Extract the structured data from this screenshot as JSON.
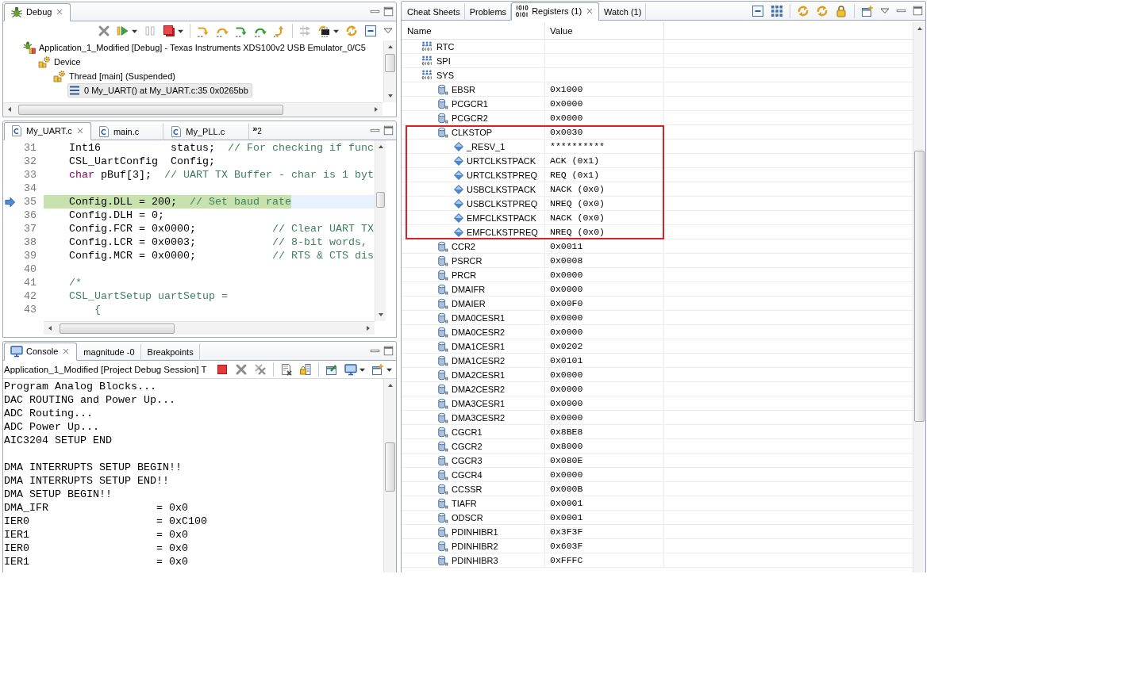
{
  "debug_view": {
    "tabs": [
      {
        "label": "Debug",
        "selected": true
      }
    ],
    "tree": [
      {
        "label": "Application_1_Modified [Debug] - Texas Instruments XDS100v2 USB Emulator_0/C5",
        "kind": "launch",
        "selected": false,
        "children": [
          {
            "label": "Device",
            "kind": "device",
            "selected": false,
            "children": [
              {
                "label": "Thread [main] (Suspended)",
                "kind": "thread",
                "selected": false,
                "children": [
                  {
                    "label": "0 My_UART() at My_UART.c:35 0x0265bb",
                    "kind": "frame",
                    "selected": true
                  }
                ]
              }
            ]
          }
        ]
      }
    ]
  },
  "editor": {
    "tabs": [
      {
        "label": "My_UART.c",
        "selected": true
      },
      {
        "label": "main.c",
        "selected": false
      },
      {
        "label": "My_PLL.c",
        "selected": false
      }
    ],
    "more_tabs": {
      "glyph": "»",
      "count": "2"
    },
    "lines": [
      {
        "number": "31",
        "current": false,
        "tokens": [
          {
            "text": "    Int16           status;  ",
            "kind": "code"
          },
          {
            "text": "// For checking if func",
            "kind": "comment"
          }
        ]
      },
      {
        "number": "32",
        "current": false,
        "tokens": [
          {
            "text": "    CSL_UartConfig  Config;",
            "kind": "code"
          }
        ]
      },
      {
        "number": "33",
        "current": false,
        "tokens": [
          {
            "text": "    char",
            "kind": "keyword"
          },
          {
            "text": " pBuf[3];  ",
            "kind": "code"
          },
          {
            "text": "// UART TX Buffer - char is 1 byt",
            "kind": "comment"
          }
        ]
      },
      {
        "number": "34",
        "current": false
      },
      {
        "number": "35",
        "current": true,
        "tokens": [
          {
            "text": "    Config.DLL = 200;  ",
            "kind": "code"
          },
          {
            "text": "// Set baud rate",
            "kind": "comment"
          }
        ]
      },
      {
        "number": "36",
        "current": false,
        "tokens": [
          {
            "text": "    Config.DLH = 0;",
            "kind": "code"
          }
        ]
      },
      {
        "number": "37",
        "current": false,
        "tokens": [
          {
            "text": "    Config.FCR = 0x0000;            ",
            "kind": "code"
          },
          {
            "text": "// Clear UART TX",
            "kind": "comment"
          }
        ]
      },
      {
        "number": "38",
        "current": false,
        "tokens": [
          {
            "text": "    Config.LCR = 0x0003;            ",
            "kind": "code"
          },
          {
            "text": "// 8-bit words,",
            "kind": "comment"
          }
        ]
      },
      {
        "number": "39",
        "current": false,
        "tokens": [
          {
            "text": "    Config.MCR = 0x0000;            ",
            "kind": "code"
          },
          {
            "text": "// RTS & CTS dis",
            "kind": "comment"
          }
        ]
      },
      {
        "number": "40",
        "current": false
      },
      {
        "number": "41",
        "current": false,
        "tokens": [
          {
            "text": "    /*",
            "kind": "comment"
          }
        ]
      },
      {
        "number": "42",
        "current": false,
        "tokens": [
          {
            "text": "    CSL_UartSetup uartSetup =",
            "kind": "comment"
          }
        ]
      },
      {
        "number": "43",
        "current": false,
        "tokens": [
          {
            "text": "        {",
            "kind": "comment"
          }
        ]
      }
    ]
  },
  "console_view": {
    "tabs": [
      {
        "label": "Console",
        "selected": true
      },
      {
        "label": "magnitude -0",
        "selected": false
      },
      {
        "label": "Breakpoints",
        "selected": false
      }
    ],
    "session": "Application_1_Modified [Project Debug Session] T",
    "paragraphs": [
      [
        "Program Analog Blocks...",
        "DAC ROUTING and Power Up...",
        "ADC Routing...",
        "ADC Power Up...",
        "AIC3204 SETUP END"
      ],
      [
        "DMA INTERRUPTS SETUP BEGIN!!",
        "DMA INTERRUPTS SETUP END!!",
        "DMA SETUP BEGIN!!",
        "DMA_IFR                 = 0x0",
        "IER0                    = 0xC100",
        "IER1                    = 0x0",
        "IER0                    = 0x0",
        "IER1                    = 0x0"
      ]
    ]
  },
  "registers_view": {
    "tabs": [
      {
        "label": "Cheat Sheets",
        "selected": false
      },
      {
        "label": "Problems",
        "selected": false
      },
      {
        "label": "Registers (1)",
        "selected": true
      },
      {
        "label": "Watch (1)",
        "selected": false
      }
    ],
    "columns": [
      "Name",
      "Value"
    ],
    "rows": [
      {
        "name": "RTC",
        "kind": "group"
      },
      {
        "name": "SPI",
        "kind": "group"
      },
      {
        "name": "SYS",
        "kind": "group",
        "children": [
          {
            "name": "EBSR",
            "value": "0x1000",
            "kind": "register",
            "highlighted": false
          },
          {
            "name": "PCGCR1",
            "value": "0x0000",
            "kind": "register",
            "highlighted": false
          },
          {
            "name": "PCGCR2",
            "value": "0x0000",
            "kind": "register",
            "highlighted": false
          },
          {
            "name": "CLKSTOP",
            "value": "0x0030",
            "kind": "register",
            "highlighted": true,
            "children": [
              {
                "name": "_RESV_1",
                "value": "**********",
                "kind": "field"
              },
              {
                "name": "URTCLKSTPACK",
                "value": "ACK (0x1)",
                "kind": "field"
              },
              {
                "name": "URTCLKSTPREQ",
                "value": "REQ (0x1)",
                "kind": "field"
              },
              {
                "name": "USBCLKSTPACK",
                "value": "NACK (0x0)",
                "kind": "field"
              },
              {
                "name": "USBCLKSTPREQ",
                "value": "NREQ (0x0)",
                "kind": "field"
              },
              {
                "name": "EMFCLKSTPACK",
                "value": "NACK (0x0)",
                "kind": "field"
              },
              {
                "name": "EMFCLKSTPREQ",
                "value": "NREQ (0x0)",
                "kind": "field"
              }
            ]
          },
          {
            "name": "CCR2",
            "value": "0x0011",
            "kind": "register",
            "highlighted": false
          },
          {
            "name": "PSRCR",
            "value": "0x0008",
            "kind": "register",
            "highlighted": false
          },
          {
            "name": "PRCR",
            "value": "0x0000",
            "kind": "register",
            "highlighted": false
          },
          {
            "name": "DMAIFR",
            "value": "0x0000",
            "kind": "register",
            "highlighted": false
          },
          {
            "name": "DMAIER",
            "value": "0x00F0",
            "kind": "register",
            "highlighted": false
          },
          {
            "name": "DMA0CESR1",
            "value": "0x0000",
            "kind": "register",
            "highlighted": false
          },
          {
            "name": "DMA0CESR2",
            "value": "0x0000",
            "kind": "register",
            "highlighted": false
          },
          {
            "name": "DMA1CESR1",
            "value": "0x0202",
            "kind": "register",
            "highlighted": false
          },
          {
            "name": "DMA1CESR2",
            "value": "0x0101",
            "kind": "register",
            "highlighted": false
          },
          {
            "name": "DMA2CESR1",
            "value": "0x0000",
            "kind": "register",
            "highlighted": false
          },
          {
            "name": "DMA2CESR2",
            "value": "0x0000",
            "kind": "register",
            "highlighted": false
          },
          {
            "name": "DMA3CESR1",
            "value": "0x0000",
            "kind": "register",
            "highlighted": false
          },
          {
            "name": "DMA3CESR2",
            "value": "0x0000",
            "kind": "register",
            "highlighted": false
          },
          {
            "name": "CGCR1",
            "value": "0x8BE8",
            "kind": "register",
            "highlighted": false
          },
          {
            "name": "CGCR2",
            "value": "0x8000",
            "kind": "register",
            "highlighted": false
          },
          {
            "name": "CGCR3",
            "value": "0x080E",
            "kind": "register",
            "highlighted": false
          },
          {
            "name": "CGCR4",
            "value": "0x0000",
            "kind": "register",
            "highlighted": false
          },
          {
            "name": "CCSSR",
            "value": "0x000B",
            "kind": "register",
            "highlighted": false
          },
          {
            "name": "TIAFR",
            "value": "0x0001",
            "kind": "register",
            "highlighted": false
          },
          {
            "name": "ODSCR",
            "value": "0x0001",
            "kind": "register",
            "highlighted": false
          },
          {
            "name": "PDINHIBR1",
            "value": "0x3F3F",
            "kind": "register",
            "highlighted": false
          },
          {
            "name": "PDINHIBR2",
            "value": "0x603F",
            "kind": "register",
            "highlighted": false
          },
          {
            "name": "PDINHIBR3",
            "value": "0xFFFC",
            "kind": "register",
            "highlighted": false
          }
        ]
      }
    ]
  }
}
